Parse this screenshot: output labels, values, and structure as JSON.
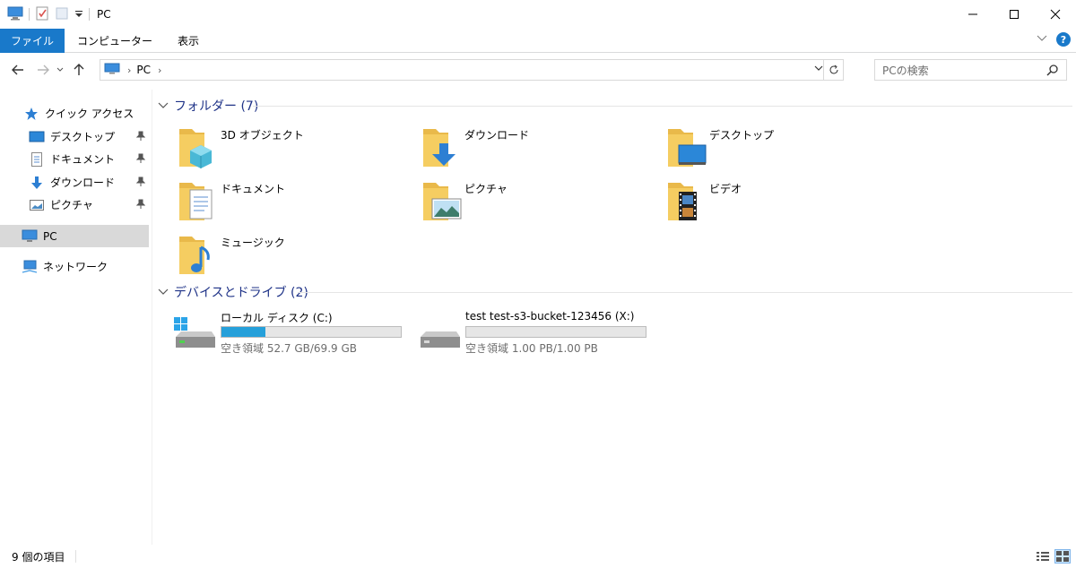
{
  "window": {
    "title": "PC"
  },
  "ribbon": {
    "tabs": [
      "ファイル",
      "コンピューター",
      "表示"
    ]
  },
  "address": {
    "crumbs": [
      "PC"
    ],
    "search_placeholder": "PCの検索"
  },
  "sidebar": {
    "quick_access": "クイック アクセス",
    "quick_items": [
      {
        "label": "デスクトップ",
        "icon": "desktop-icon"
      },
      {
        "label": "ドキュメント",
        "icon": "documents-icon"
      },
      {
        "label": "ダウンロード",
        "icon": "downloads-icon"
      },
      {
        "label": "ピクチャ",
        "icon": "pictures-icon"
      }
    ],
    "pc": "PC",
    "network": "ネットワーク"
  },
  "groups": {
    "folders_header": "フォルダー (7)",
    "devices_header": "デバイスとドライブ (2)"
  },
  "folders": [
    {
      "label": "3D オブジェクト",
      "icon": "3d-objects-folder-icon"
    },
    {
      "label": "ダウンロード",
      "icon": "downloads-folder-icon"
    },
    {
      "label": "デスクトップ",
      "icon": "desktop-folder-icon"
    },
    {
      "label": "ドキュメント",
      "icon": "documents-folder-icon"
    },
    {
      "label": "ピクチャ",
      "icon": "pictures-folder-icon"
    },
    {
      "label": "ビデオ",
      "icon": "videos-folder-icon"
    },
    {
      "label": "ミュージック",
      "icon": "music-folder-icon"
    }
  ],
  "drives": [
    {
      "label": "ローカル ディスク (C:)",
      "free_text": "空き領域 52.7 GB/69.9 GB",
      "used_fraction": 0.246,
      "icon": "windows-drive-icon"
    },
    {
      "label": "test test-s3-bucket-123456 (X:)",
      "free_text": "空き領域 1.00 PB/1.00 PB",
      "used_fraction": 0.0,
      "icon": "network-drive-icon"
    }
  ],
  "status": {
    "count": "9 個の項目"
  },
  "colors": {
    "accent": "#1979ca",
    "folder": "#f5cd61",
    "usage_bar": "#26a0da",
    "group_header": "#1e3287"
  }
}
